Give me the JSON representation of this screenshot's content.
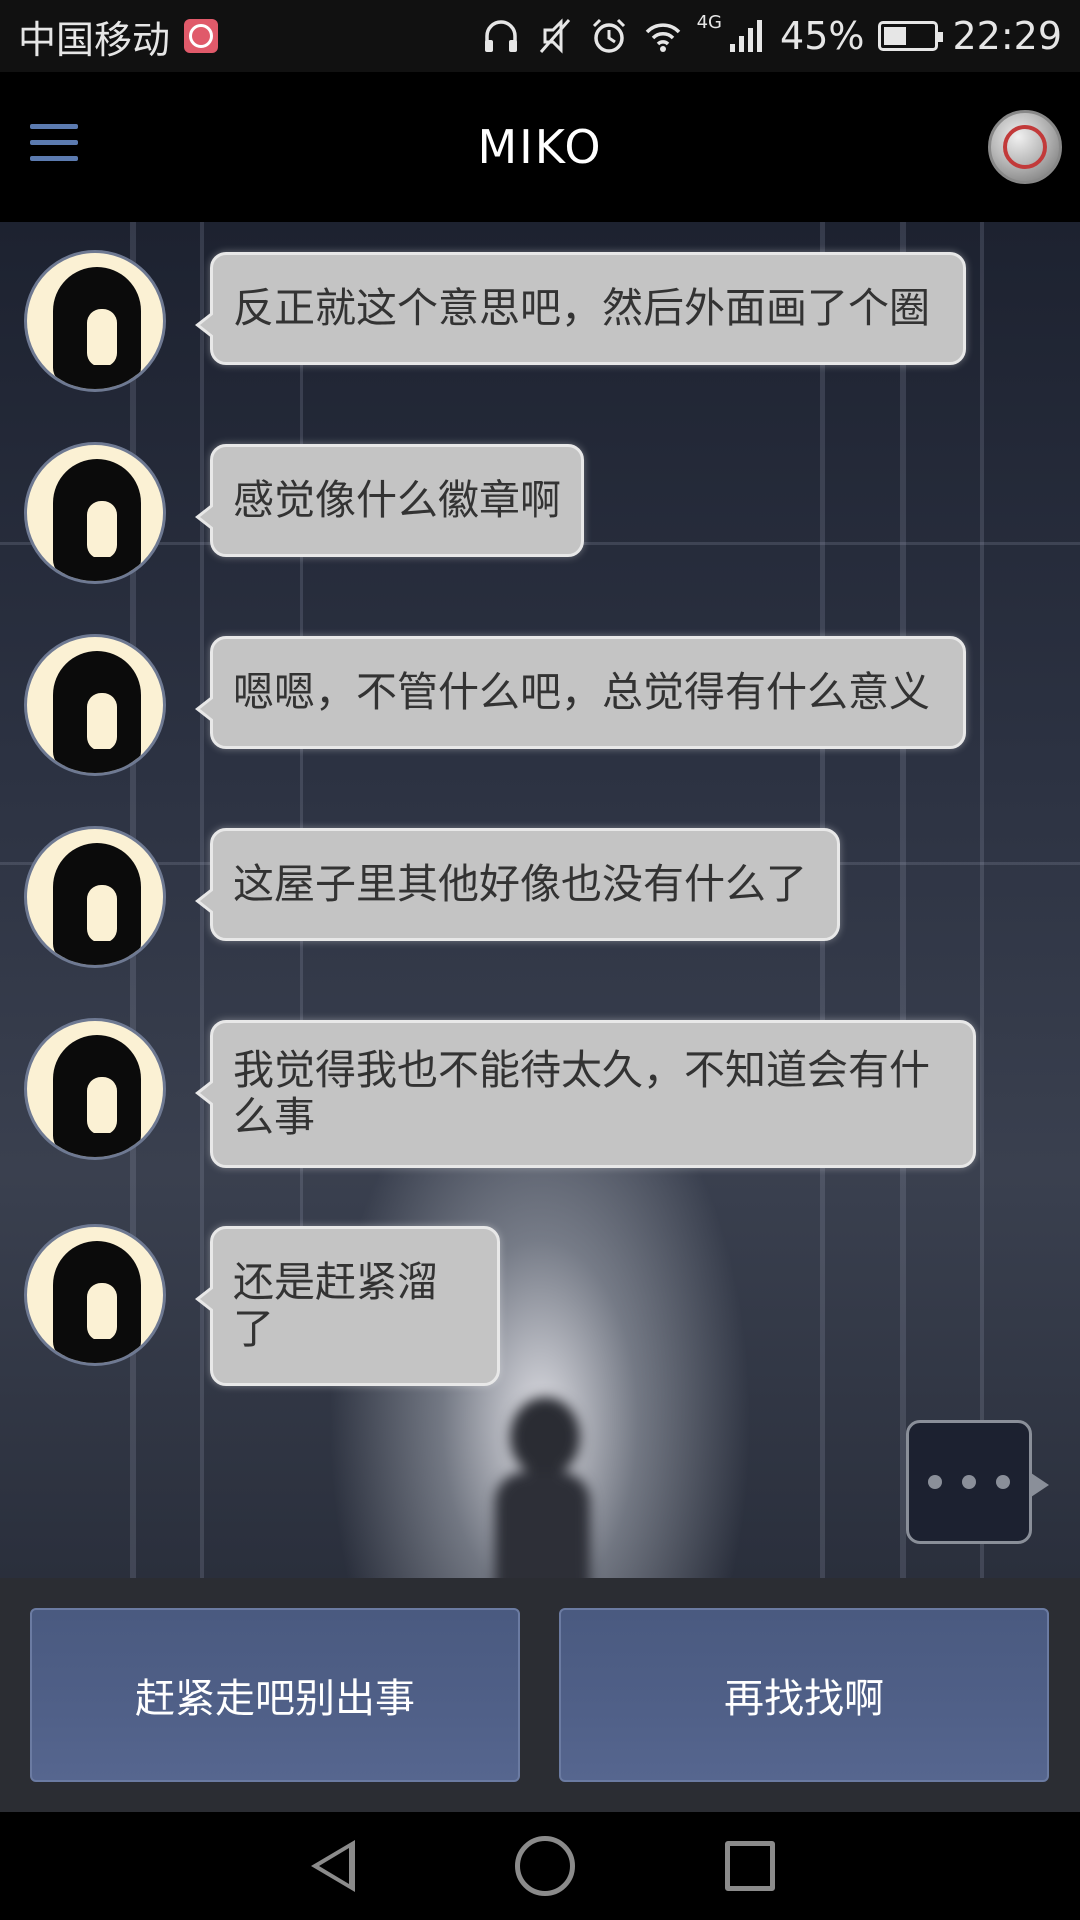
{
  "status_bar": {
    "carrier": "中国移动",
    "network_type": "4G",
    "battery_percent": "45%",
    "battery_level": 0.45,
    "time": "22:29",
    "icons": [
      "headphones-icon",
      "mute-icon",
      "alarm-icon",
      "wifi-icon",
      "signal-icon",
      "battery-icon"
    ]
  },
  "header": {
    "title": "MIKO"
  },
  "messages": [
    {
      "text": "反正就这个意思吧，然后外面画了个圈"
    },
    {
      "text": "感觉像什么徽章啊"
    },
    {
      "text": "嗯嗯，不管什么吧，总觉得有什么意义"
    },
    {
      "text": "这屋子里其他好像也没有什么了"
    },
    {
      "text": "我觉得我也不能待太久，不知道会有什么事"
    },
    {
      "text": "还是赶紧溜了"
    }
  ],
  "choices": {
    "left": "赶紧走吧别出事",
    "right": "再找找啊"
  },
  "colors": {
    "accent": "#5c7bb0",
    "choice_button": "#4e5e86",
    "bubble": "#c4c4c4",
    "avatar_bg": "#fbf1d4"
  }
}
